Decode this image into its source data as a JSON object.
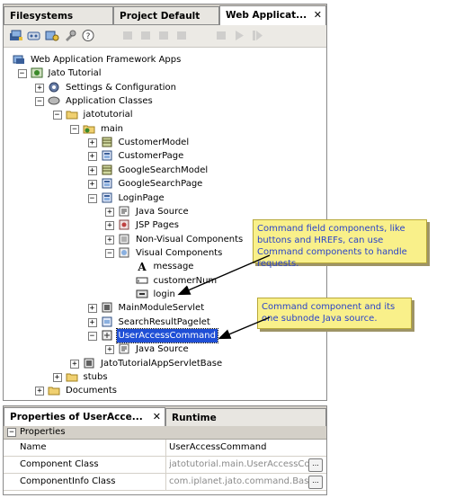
{
  "explorer": {
    "tabs": [
      {
        "label": "Filesystems",
        "active": false
      },
      {
        "label": "Project Default",
        "active": false
      },
      {
        "label": "Web Applicat...",
        "active": true
      }
    ],
    "close_glyph": "✕",
    "toolbar_icons": [
      "new-app-icon",
      "deploy-icon",
      "config-icon",
      "tool-icon",
      "help-icon",
      "disabled-icon-1",
      "disabled-icon-2",
      "disabled-icon-3",
      "disabled-icon-4",
      "disabled-icon-5",
      "disabled-icon-6",
      "disabled-icon-7"
    ]
  },
  "tree": {
    "nodes": [
      {
        "label": "Web Application Framework Apps",
        "icon": "apps-root-icon",
        "expander": ""
      },
      {
        "label": "Jato Tutorial",
        "icon": "app-icon",
        "expander": "−"
      },
      {
        "label": "Settings & Configuration",
        "icon": "settings-icon",
        "expander": "+"
      },
      {
        "label": "Application Classes",
        "icon": "classes-icon",
        "expander": "−"
      },
      {
        "label": "jatotutorial",
        "icon": "folder-icon",
        "expander": "−"
      },
      {
        "label": "main",
        "icon": "module-folder-icon",
        "expander": "−"
      },
      {
        "label": "CustomerModel",
        "icon": "model-icon",
        "expander": "+"
      },
      {
        "label": "CustomerPage",
        "icon": "page-icon",
        "expander": "+"
      },
      {
        "label": "GoogleSearchModel",
        "icon": "model-icon",
        "expander": "+"
      },
      {
        "label": "GoogleSearchPage",
        "icon": "page-icon",
        "expander": "+"
      },
      {
        "label": "LoginPage",
        "icon": "page-icon",
        "expander": "−"
      },
      {
        "label": "Java Source",
        "icon": "java-source-icon",
        "expander": "+"
      },
      {
        "label": "JSP Pages",
        "icon": "jsp-icon",
        "expander": "+"
      },
      {
        "label": "Non-Visual Components",
        "icon": "nonvisual-icon",
        "expander": "+"
      },
      {
        "label": "Visual Components",
        "icon": "visual-icon",
        "expander": "−"
      },
      {
        "label": "message",
        "icon": "text-component-icon",
        "expander": ""
      },
      {
        "label": "customerNum",
        "icon": "textfield-component-icon",
        "expander": ""
      },
      {
        "label": "login",
        "icon": "button-component-icon",
        "expander": ""
      },
      {
        "label": "MainModuleServlet",
        "icon": "servlet-icon",
        "expander": "+"
      },
      {
        "label": "SearchResultPagelet",
        "icon": "pagelet-icon",
        "expander": "+"
      },
      {
        "label": "UserAccessCommand",
        "icon": "command-icon",
        "expander": "−",
        "selected": true
      },
      {
        "label": "Java Source",
        "icon": "java-source-icon",
        "expander": "+"
      },
      {
        "label": "JatoTutorialAppServletBase",
        "icon": "servlet-icon",
        "expander": "+"
      },
      {
        "label": "stubs",
        "icon": "folder-icon",
        "expander": "+"
      },
      {
        "label": "Documents",
        "icon": "folder-icon",
        "expander": "+"
      }
    ]
  },
  "callouts": [
    {
      "text": "Command field components, like buttons and HREFs, can use Command components to handle requests."
    },
    {
      "text": "Command component and its one subnode  Java source."
    }
  ],
  "properties": {
    "tabs": [
      {
        "label": "Properties of UserAcce...",
        "active": true
      },
      {
        "label": "Runtime",
        "active": false
      }
    ],
    "close_glyph": "✕",
    "section": "Properties",
    "section_toggle": "−",
    "rows": [
      {
        "name": "Name",
        "value": "UserAccessCommand",
        "dim": false,
        "button": false
      },
      {
        "name": "Component Class",
        "value": "jatotutorial.main.UserAccessCo...",
        "dim": true,
        "button": true
      },
      {
        "name": "ComponentInfo Class",
        "value": "com.iplanet.jato.command.Basic...",
        "dim": true,
        "button": true
      }
    ],
    "button_label": "..."
  }
}
